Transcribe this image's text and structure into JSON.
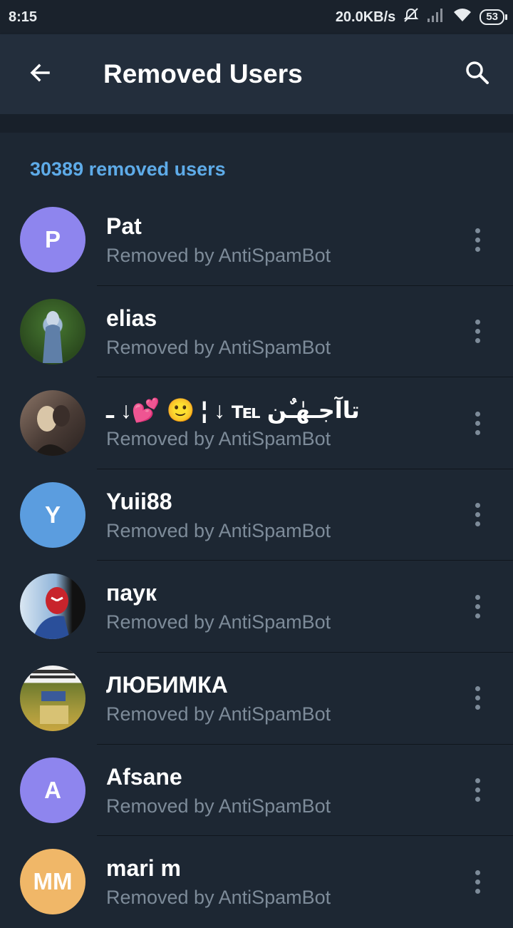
{
  "status_bar": {
    "time": "8:15",
    "net_speed": "20.0KB/s",
    "battery": "53"
  },
  "app_bar": {
    "title": "Removed Users",
    "back_icon": "arrow-left-icon",
    "search_icon": "search-icon"
  },
  "header": {
    "count_label": "30389 removed users"
  },
  "colors": {
    "accent": "#5eabe8",
    "background": "#1d2733",
    "appbar": "#232e3c"
  },
  "users": [
    {
      "name": "Pat",
      "sub": "Removed by AntiSpamBot",
      "initials": "P",
      "avatar_color": "#8e85ee"
    },
    {
      "name": "elias",
      "sub": "Removed by AntiSpamBot",
      "initials": "",
      "avatar_color": "#4e7a3a"
    },
    {
      "name": "تاآجـهٰـٌن ℡ ↓ ¦ 🙂 💕↓ ـ",
      "sub": "Removed by AntiSpamBot",
      "initials": "",
      "avatar_color": "#6b5a52"
    },
    {
      "name": "Yuii88",
      "sub": "Removed by AntiSpamBot",
      "initials": "Y",
      "avatar_color": "#5b9ddf"
    },
    {
      "name": "паук",
      "sub": "Removed by AntiSpamBot",
      "initials": "",
      "avatar_color": "#b8323a"
    },
    {
      "name": "ЛЮБИМКА",
      "sub": "Removed by AntiSpamBot",
      "initials": "",
      "avatar_color": "#7a8a3a"
    },
    {
      "name": "Afsane",
      "sub": "Removed by AntiSpamBot",
      "initials": "A",
      "avatar_color": "#8e85ee"
    },
    {
      "name": "mari m",
      "sub": "Removed by AntiSpamBot",
      "initials": "MM",
      "avatar_color": "#f0b768"
    }
  ]
}
